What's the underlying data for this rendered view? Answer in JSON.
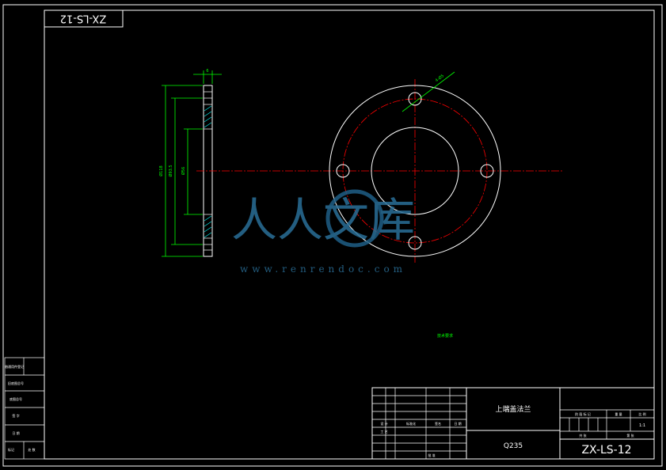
{
  "drawing": {
    "code_top": "ZX-LS-12",
    "code_block": "ZX-LS-12",
    "part_name": "上端盖法兰",
    "material": "Q235",
    "note": "技术要求"
  },
  "dims": {
    "thickness": "6",
    "outer_dia": "Ø118",
    "pcd": "Ø93.5",
    "bore": "Ø56",
    "holes": "4-Ø5"
  },
  "left_strip": {
    "r1": "借通用件登记",
    "r2": "旧底图总号",
    "r3": "底图总号",
    "r4": "签 字",
    "r5": "日 期",
    "r6a": "标记",
    "r6b": "处 数"
  },
  "title_block": {
    "design": "设 计",
    "std": "标准化",
    "signed": "签名",
    "date": "日 期",
    "process": "工 艺",
    "stage_mark": "阶 段 标 记",
    "weight": "重 量",
    "scale": "比 例",
    "scale_val": "1:1",
    "sheets": "共 张",
    "sheet_of": "第 张",
    "approve": "批 准"
  },
  "watermark": {
    "brand": "人人文库",
    "url": "www.renrendoc.com"
  }
}
